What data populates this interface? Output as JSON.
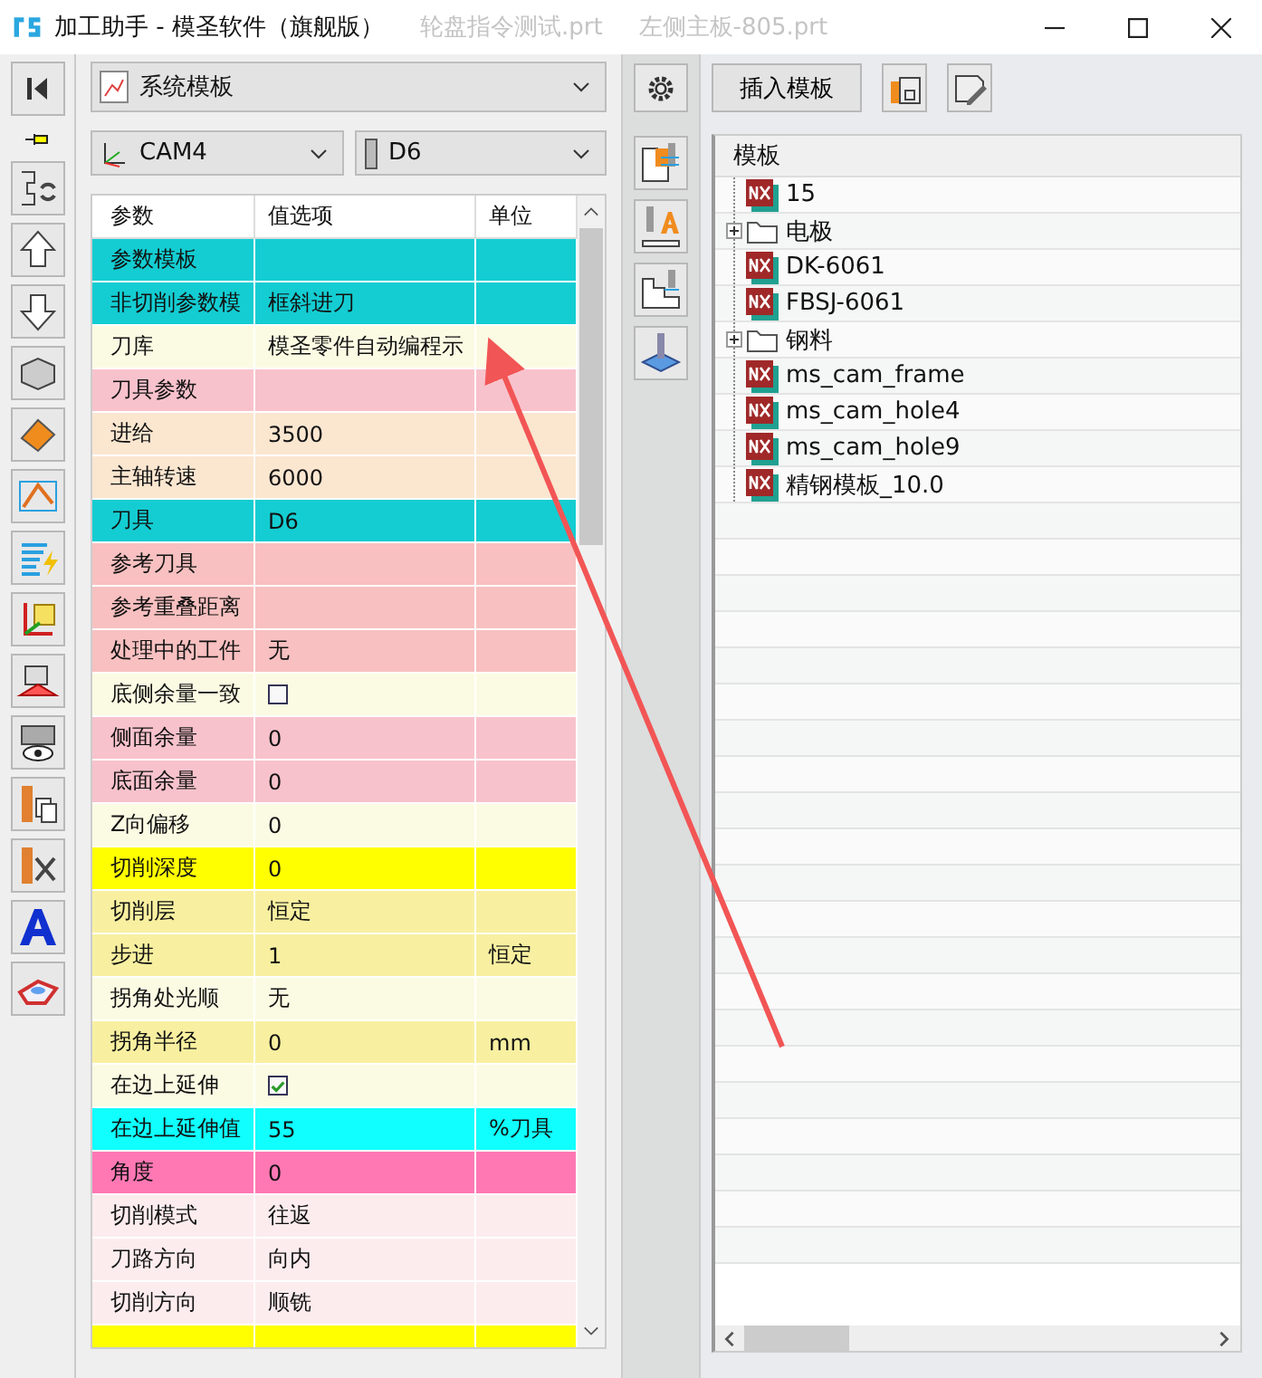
{
  "window": {
    "title": "加工助手 - 模圣软件（旗舰版）",
    "background_tabs": [
      "轮盘指令测试.prt",
      "左侧主板-805.prt"
    ]
  },
  "template_select": {
    "value": "系统模板"
  },
  "csys_select": {
    "value": "CAM4"
  },
  "tool_select": {
    "value": "D6"
  },
  "param_table": {
    "columns": [
      "参数",
      "值选项",
      "单位"
    ],
    "rows": [
      {
        "kind": "text",
        "label": "参数模板",
        "color": "#14cdd2"
      },
      {
        "kind": "text",
        "label": "非切削参数模",
        "value": "框斜进刀",
        "color": "#14cdd2"
      },
      {
        "kind": "text",
        "label": "刀库",
        "value": "模圣零件自动编程示",
        "color": "#fbfbe3"
      },
      {
        "kind": "text",
        "label": "刀具参数",
        "color": "#f8c2cc"
      },
      {
        "kind": "text",
        "label": "进给",
        "value": "3500",
        "color": "#fbe6d0"
      },
      {
        "kind": "text",
        "label": "主轴转速",
        "value": "6000",
        "color": "#fbe6d0"
      },
      {
        "kind": "text",
        "label": "刀具",
        "value": "D6",
        "color": "#14cdd2"
      },
      {
        "kind": "text",
        "label": "参考刀具",
        "color": "#f8c0c0"
      },
      {
        "kind": "text",
        "label": "参考重叠距离",
        "color": "#f8c0c0"
      },
      {
        "kind": "text",
        "label": "处理中的工件",
        "value": "无",
        "color": "#f8c0c0"
      },
      {
        "kind": "checkbox",
        "label": "底侧余量一致",
        "checked": false,
        "color": "#fbfbe3"
      },
      {
        "kind": "text",
        "label": "侧面余量",
        "value": "0",
        "color": "#f8c2cc"
      },
      {
        "kind": "text",
        "label": "底面余量",
        "value": "0",
        "color": "#f8c2cc"
      },
      {
        "kind": "text",
        "label": "Z向偏移",
        "value": "0",
        "color": "#fbfbe3"
      },
      {
        "kind": "text",
        "label": "切削深度",
        "value": "0",
        "color": "#ffff00"
      },
      {
        "kind": "text",
        "label": "切削层",
        "value": "恒定",
        "color": "#f8f0a0"
      },
      {
        "kind": "text",
        "label": "步进",
        "value": "1",
        "unit": "恒定",
        "color": "#f8f0a0"
      },
      {
        "kind": "text",
        "label": "拐角处光顺",
        "value": "无",
        "color": "#fbfbe3"
      },
      {
        "kind": "text",
        "label": "拐角半径",
        "value": "0",
        "unit": "mm",
        "color": "#f8f0a0"
      },
      {
        "kind": "checkbox",
        "label": "在边上延伸",
        "checked": true,
        "color": "#fbfbe3"
      },
      {
        "kind": "text",
        "label": "在边上延伸值",
        "value": "55",
        "unit": "%刀具",
        "color": "#10ffff"
      },
      {
        "kind": "text",
        "label": "角度",
        "value": "0",
        "color": "#ff78b4"
      },
      {
        "kind": "text",
        "label": "切削模式",
        "value": "往返",
        "color": "#fcecee"
      },
      {
        "kind": "text",
        "label": "刀路方向",
        "value": "向内",
        "color": "#fcecee"
      },
      {
        "kind": "text",
        "label": "切削方向",
        "value": "顺铣",
        "color": "#fcecee"
      },
      {
        "kind": "blank",
        "color": "#ffff00"
      }
    ]
  },
  "insert_button": {
    "label": "插入模板"
  },
  "tree": {
    "header": "模板",
    "items": [
      {
        "kind": "file",
        "label": "15"
      },
      {
        "kind": "folder",
        "label": "电极",
        "expanded": false
      },
      {
        "kind": "file",
        "label": "DK-6061"
      },
      {
        "kind": "file",
        "label": "FBSJ-6061"
      },
      {
        "kind": "folder",
        "label": "钢料",
        "expanded": false
      },
      {
        "kind": "file",
        "label": "ms_cam_frame"
      },
      {
        "kind": "file",
        "label": "ms_cam_hole4"
      },
      {
        "kind": "file",
        "label": "ms_cam_hole9"
      },
      {
        "kind": "file",
        "label": "精钢模板_10.0"
      }
    ]
  }
}
